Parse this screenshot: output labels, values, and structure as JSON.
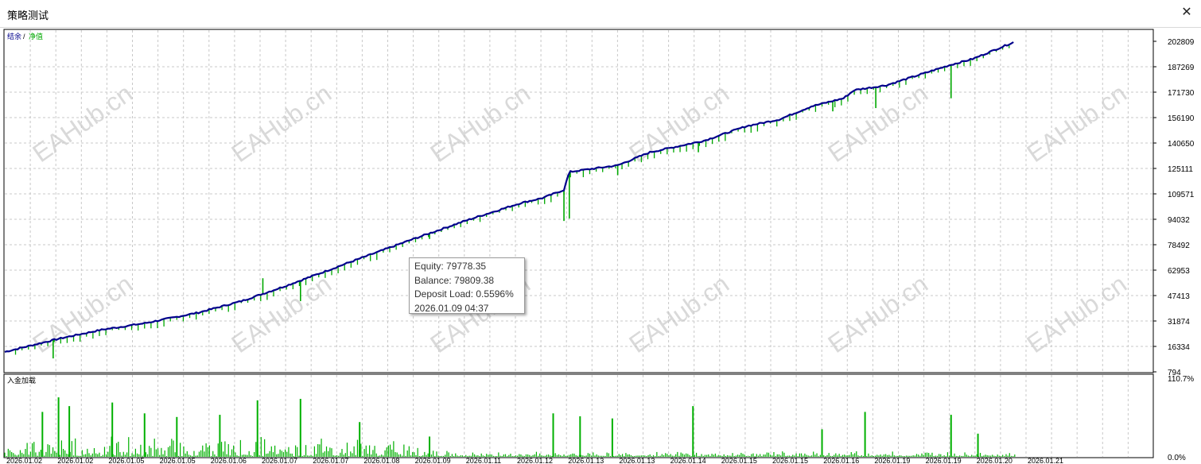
{
  "window": {
    "title": "策略测试"
  },
  "icons": {
    "close": "close-icon"
  },
  "colors": {
    "balance": "#00008b",
    "equity": "#00a800",
    "load_bar": "#00b000",
    "grid": "#c8c8c8",
    "watermark": "#d9d9d9"
  },
  "watermark": "EAHub.cn",
  "chart_data": [
    {
      "type": "line",
      "legend": [
        "结余",
        "净值"
      ],
      "legend_separator": "/",
      "grid": true,
      "y_ticks": [
        "202809",
        "187269",
        "171730",
        "156190",
        "140650",
        "125111",
        "109571",
        "94032",
        "78492",
        "62953",
        "47413",
        "31874",
        "16334",
        "794"
      ],
      "ylim": [
        794,
        202809
      ],
      "x_range": [
        "2026.01.02",
        "2026.01.21"
      ],
      "series": [
        {
          "name": "结余",
          "points": [
            [
              0,
              13000
            ],
            [
              0.05,
              21000
            ],
            [
              0.09,
              26500
            ],
            [
              0.13,
              30500
            ],
            [
              0.18,
              37000
            ],
            [
              0.22,
              44000
            ],
            [
              0.26,
              53000
            ],
            [
              0.33,
              70000
            ],
            [
              0.38,
              82000
            ],
            [
              0.43,
              93500
            ],
            [
              0.48,
              104000
            ],
            [
              0.5,
              107000
            ],
            [
              0.52,
              112000
            ],
            [
              0.525,
              123000
            ],
            [
              0.57,
              127000
            ],
            [
              0.6,
              135000
            ],
            [
              0.65,
              142000
            ],
            [
              0.69,
              151000
            ],
            [
              0.72,
              155000
            ],
            [
              0.75,
              163000
            ],
            [
              0.78,
              168000
            ],
            [
              0.79,
              173000
            ],
            [
              0.82,
              176000
            ],
            [
              0.88,
              188500
            ],
            [
              0.9,
              192000
            ],
            [
              0.94,
              202809
            ]
          ]
        }
      ],
      "equity_drops": [
        [
          0.045,
          9000
        ],
        [
          0.24,
          58000
        ],
        [
          0.275,
          44000
        ],
        [
          0.395,
          82000
        ],
        [
          0.52,
          93000
        ],
        [
          0.525,
          94500
        ],
        [
          0.57,
          121000
        ],
        [
          0.645,
          135000
        ],
        [
          0.77,
          160000
        ],
        [
          0.81,
          162000
        ],
        [
          0.88,
          168000
        ]
      ]
    },
    {
      "type": "bar",
      "title": "入金加载",
      "y_ticks": [
        "110.7%",
        "0.0%"
      ],
      "ylim": [
        0,
        110.7
      ],
      "peaks": [
        [
          0.035,
          62
        ],
        [
          0.05,
          82
        ],
        [
          0.06,
          70
        ],
        [
          0.1,
          75
        ],
        [
          0.13,
          60
        ],
        [
          0.16,
          55
        ],
        [
          0.2,
          58
        ],
        [
          0.235,
          78
        ],
        [
          0.275,
          80
        ],
        [
          0.33,
          48
        ],
        [
          0.395,
          28
        ],
        [
          0.51,
          60
        ],
        [
          0.535,
          56
        ],
        [
          0.565,
          53
        ],
        [
          0.64,
          70
        ],
        [
          0.76,
          38
        ],
        [
          0.8,
          62
        ],
        [
          0.88,
          58
        ],
        [
          0.905,
          32
        ]
      ],
      "x_labels": [
        "2026.01.02",
        "2026.01.02",
        "2026.01.05",
        "2026.01.05",
        "2026.01.06",
        "2026.01.07",
        "2026.01.07",
        "2026.01.08",
        "2026.01.09",
        "2026.01.11",
        "2026.01.12",
        "2026.01.13",
        "2026.01.13",
        "2026.01.14",
        "2026.01.15",
        "2026.01.15",
        "2026.01.16",
        "2026.01.19",
        "2026.01.19",
        "2026.01.20",
        "2026.01.21"
      ]
    }
  ],
  "tooltip": {
    "equity": "Equity: 79778.35",
    "balance": "Balance: 79809.38",
    "deposit_load": "Deposit Load: 0.5596%",
    "time": "2026.01.09 04:37"
  }
}
